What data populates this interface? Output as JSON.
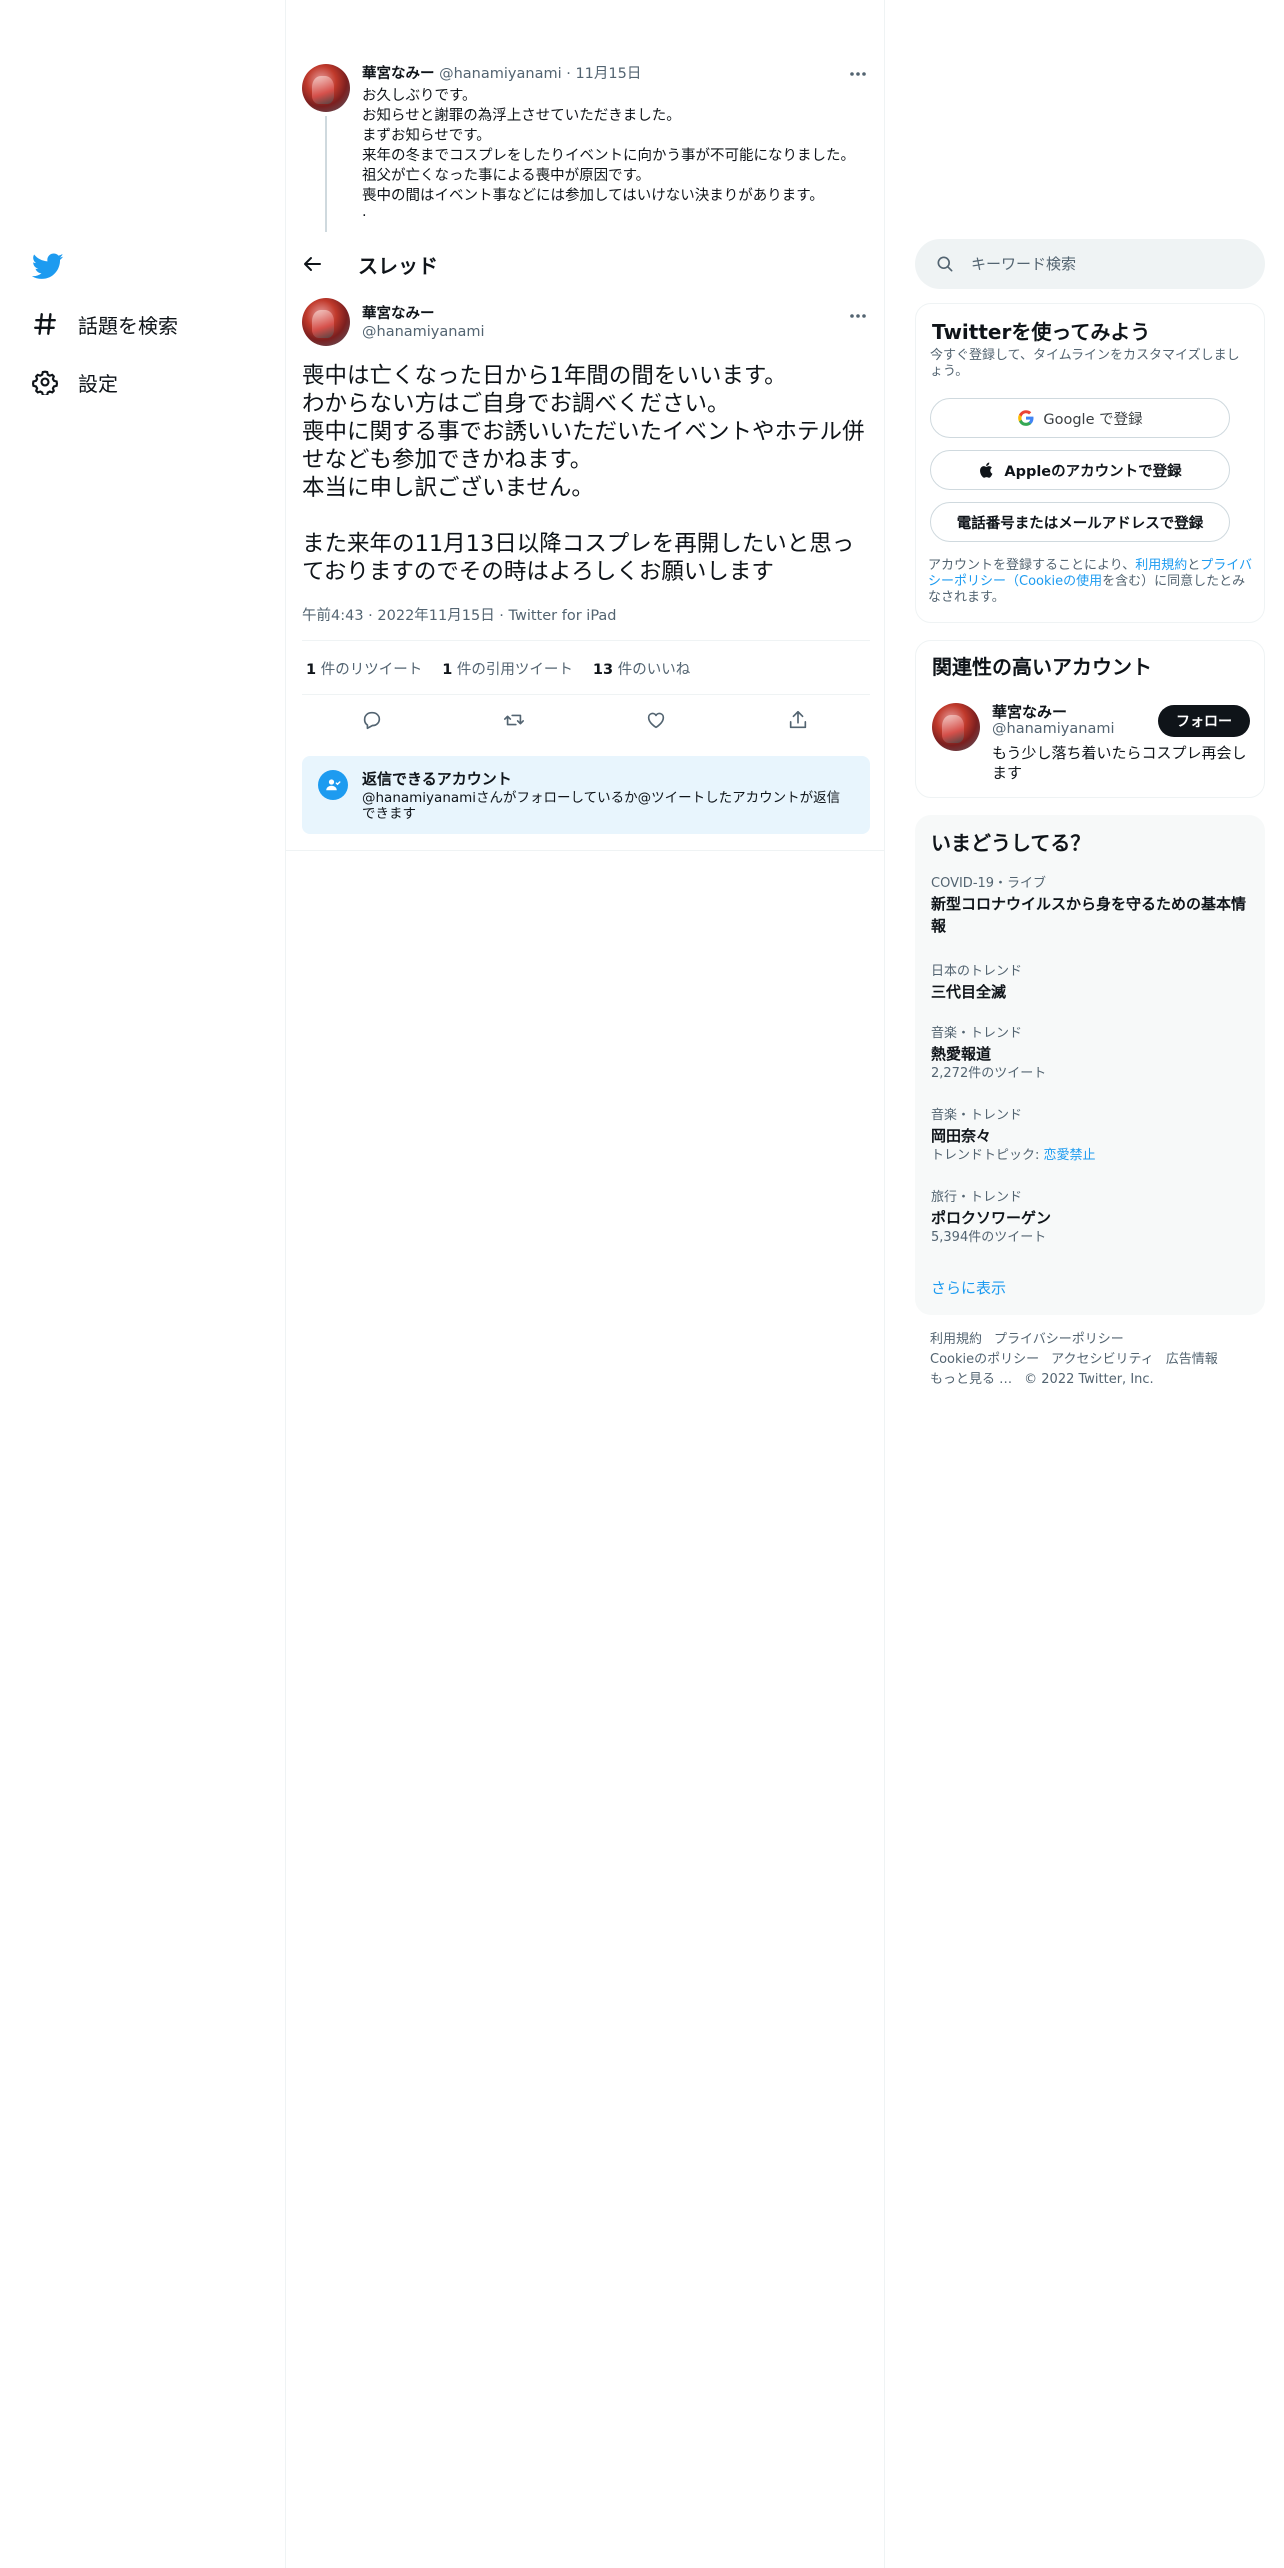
{
  "nav": {
    "explore_label": "話題を検索",
    "settings_label": "設定"
  },
  "parent_tweet": {
    "name": "華宮なみー",
    "handle": "@hanamiyanami",
    "separator": " · ",
    "date": "11月15日",
    "text": "お久しぶりです。\nお知らせと謝罪の為浮上させていただきました。\nまずお知らせです。\n来年の冬までコスプレをしたりイベントに向かう事が不可能になりました。\n祖父が亡くなった事による喪中が原因です。\n喪中の間はイベント事などには参加してはいけない決まりがあります。\n·"
  },
  "thread_header": {
    "title": "スレッド"
  },
  "main_tweet": {
    "name": "華宮なみー",
    "handle": "@hanamiyanami",
    "text": "喪中は亡くなった日から1年間の間をいいます。\nわからない方はご自身でお調べください。\n喪中に関する事でお誘いいただいたイベントやホテル併せなども参加できかねます。\n本当に申し訳ございません。\n\nまた来年の11月13日以降コスプレを再開したいと思っておりますのでその時はよろしくお願いします",
    "time": "午前4:43",
    "date": "2022年11月15日",
    "source": "Twitter for iPad",
    "meta_sep": " · "
  },
  "stats": {
    "retweets_count": "1",
    "retweets_label": " 件のリツイート",
    "quotes_count": "1",
    "quotes_label": " 件の引用ツイート",
    "likes_count": "13",
    "likes_label": " 件のいいね"
  },
  "reply_notice": {
    "title": "返信できるアカウント",
    "description": "@hanamiyanamiさんがフォローしているか@ツイートしたアカウントが返信できます"
  },
  "search": {
    "placeholder": "キーワード検索"
  },
  "signup": {
    "title": "Twitterを使ってみよう",
    "subtitle": "今すぐ登録して、タイムラインをカスタマイズしましょう。",
    "google_button": "Google で登録",
    "apple_button": "Appleのアカウントで登録",
    "phone_button": "電話番号またはメールアドレスで登録",
    "terms_prefix": "アカウントを登録することにより、",
    "terms_link1": "利用規約",
    "terms_and": "と",
    "terms_link2": "プライバシーポリシー",
    "terms_paren_open": "（",
    "terms_link3": "Cookieの使用",
    "terms_suffix": "を含む）に同意したとみなされます。"
  },
  "related": {
    "title": "関連性の高いアカウント",
    "name": "華宮なみー",
    "handle": "@hanamiyanami",
    "follow_label": "フォロー",
    "bio": "もう少し落ち着いたらコスプレ再会します"
  },
  "trends": {
    "title": "いまどうしてる？",
    "items": [
      {
        "context": "COVID-19・ライブ",
        "title": "新型コロナウイルスから身を守るための基本情報",
        "count": ""
      },
      {
        "context": "日本のトレンド",
        "title": "三代目全滅",
        "count": ""
      },
      {
        "context": "音楽・トレンド",
        "title": "熱愛報道",
        "count": "2,272件のツイート"
      },
      {
        "context": "音楽・トレンド",
        "title": "岡田奈々",
        "count_prefix": "トレンドトピック: ",
        "count_link": "恋愛禁止"
      },
      {
        "context": "旅行・トレンド",
        "title": "ポロクソワーゲン",
        "count": "5,394件のツイート"
      }
    ],
    "show_more": "さらに表示"
  },
  "footer": {
    "terms": "利用規約",
    "privacy": "プライバシーポリシー",
    "cookie": "Cookieのポリシー",
    "accessibility": "アクセシビリティ",
    "ads": "広告情報",
    "more": "もっと見る …",
    "copyright": "© 2022 Twitter, Inc."
  },
  "colors": {
    "accent": "#1d9bf0",
    "text": "#0f1419",
    "secondary": "#536471",
    "reply_bg": "#e8f5fd"
  }
}
